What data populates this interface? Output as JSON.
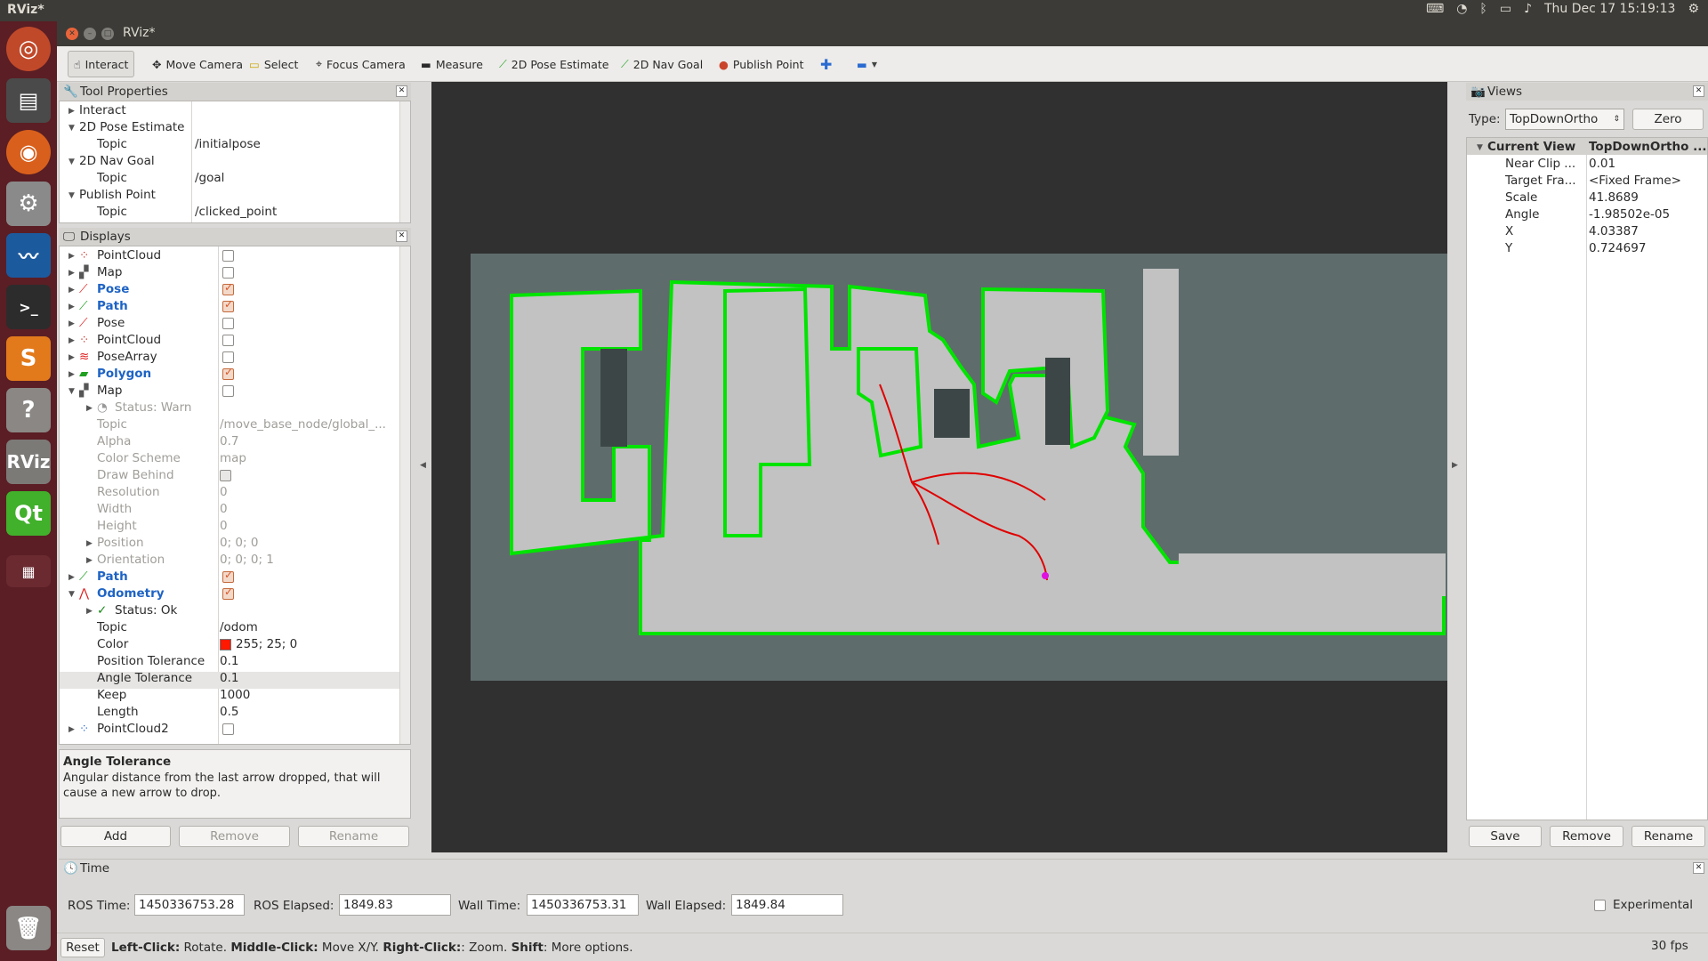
{
  "system_bar": {
    "app_name": "RViz*",
    "datetime": "Thu Dec 17 15:19:13"
  },
  "window": {
    "title": "RViz*"
  },
  "toolbar": {
    "tools": [
      "Interact",
      "Move Camera",
      "Select",
      "Focus Camera",
      "Measure",
      "2D Pose Estimate",
      "2D Nav Goal",
      "Publish Point"
    ]
  },
  "tool_properties": {
    "title": "Tool Properties",
    "rows": [
      {
        "name": "Interact",
        "value": ""
      },
      {
        "name": "2D Pose Estimate",
        "value": ""
      },
      {
        "name": "Topic",
        "value": "/initialpose"
      },
      {
        "name": "2D Nav Goal",
        "value": ""
      },
      {
        "name": "Topic",
        "value": "/goal"
      },
      {
        "name": "Publish Point",
        "value": ""
      },
      {
        "name": "Topic",
        "value": "/clicked_point"
      }
    ]
  },
  "displays": {
    "title": "Displays",
    "rows": [
      {
        "name": "PointCloud",
        "value": "",
        "checked": false
      },
      {
        "name": "Map",
        "value": "",
        "checked": false
      },
      {
        "name": "Pose",
        "value": "",
        "checked": true
      },
      {
        "name": "Path",
        "value": "",
        "checked": true
      },
      {
        "name": "Pose",
        "value": "",
        "checked": false
      },
      {
        "name": "PointCloud",
        "value": "",
        "checked": false
      },
      {
        "name": "PoseArray",
        "value": "",
        "checked": false
      },
      {
        "name": "Polygon",
        "value": "",
        "checked": true
      },
      {
        "name": "Map",
        "value": "",
        "checked": false
      },
      {
        "name": "Status: Warn",
        "value": ""
      },
      {
        "name": "Topic",
        "value": "/move_base_node/global_..."
      },
      {
        "name": "Alpha",
        "value": "0.7"
      },
      {
        "name": "Color Scheme",
        "value": "map"
      },
      {
        "name": "Draw Behind",
        "value": ""
      },
      {
        "name": "Resolution",
        "value": "0"
      },
      {
        "name": "Width",
        "value": "0"
      },
      {
        "name": "Height",
        "value": "0"
      },
      {
        "name": "Position",
        "value": "0; 0; 0"
      },
      {
        "name": "Orientation",
        "value": "0; 0; 0; 1"
      },
      {
        "name": "Path",
        "value": "",
        "checked": true
      },
      {
        "name": "Odometry",
        "value": "",
        "checked": true
      },
      {
        "name": "Status: Ok",
        "value": ""
      },
      {
        "name": "Topic",
        "value": "/odom"
      },
      {
        "name": "Color",
        "value": "255; 25; 0"
      },
      {
        "name": "Position Tolerance",
        "value": "0.1"
      },
      {
        "name": "Angle Tolerance",
        "value": "0.1"
      },
      {
        "name": "Keep",
        "value": "1000"
      },
      {
        "name": "Length",
        "value": "0.5"
      },
      {
        "name": "PointCloud2",
        "value": "",
        "checked": false
      }
    ],
    "description_title": "Angle Tolerance",
    "description_text": "Angular distance from the last arrow dropped, that will cause a new arrow to drop.",
    "buttons": {
      "add": "Add",
      "remove": "Remove",
      "rename": "Rename"
    }
  },
  "views": {
    "title": "Views",
    "type_label": "Type:",
    "type_value": "TopDownOrtho",
    "zero_button": "Zero",
    "rows": [
      {
        "name": "Current View",
        "value": "TopDownOrtho ..."
      },
      {
        "name": "Near Clip ...",
        "value": "0.01"
      },
      {
        "name": "Target Fra...",
        "value": "<Fixed Frame>"
      },
      {
        "name": "Scale",
        "value": "41.8689"
      },
      {
        "name": "Angle",
        "value": "-1.98502e-05"
      },
      {
        "name": "X",
        "value": "4.03387"
      },
      {
        "name": "Y",
        "value": "0.724697"
      }
    ],
    "buttons": {
      "save": "Save",
      "remove": "Remove",
      "rename": "Rename"
    }
  },
  "time": {
    "title": "Time",
    "ros_time_label": "ROS Time:",
    "ros_time": "1450336753.28",
    "ros_elapsed_label": "ROS Elapsed:",
    "ros_elapsed": "1849.83",
    "wall_time_label": "Wall Time:",
    "wall_time": "1450336753.31",
    "wall_elapsed_label": "Wall Elapsed:",
    "wall_elapsed": "1849.84",
    "experimental": "Experimental"
  },
  "statusbar": {
    "reset": "Reset",
    "hint_parts": [
      "Left-Click:",
      " Rotate. ",
      "Middle-Click:",
      " Move X/Y. ",
      "Right-Click:",
      ": Zoom. ",
      "Shift",
      ": More options."
    ],
    "fps": "30 fps"
  },
  "colors": {
    "odometry_color": "#ff1900",
    "map_bg": "#5f6c6c",
    "free": "#c2c2c2",
    "wall": "#00e400",
    "path": "#e00000"
  }
}
